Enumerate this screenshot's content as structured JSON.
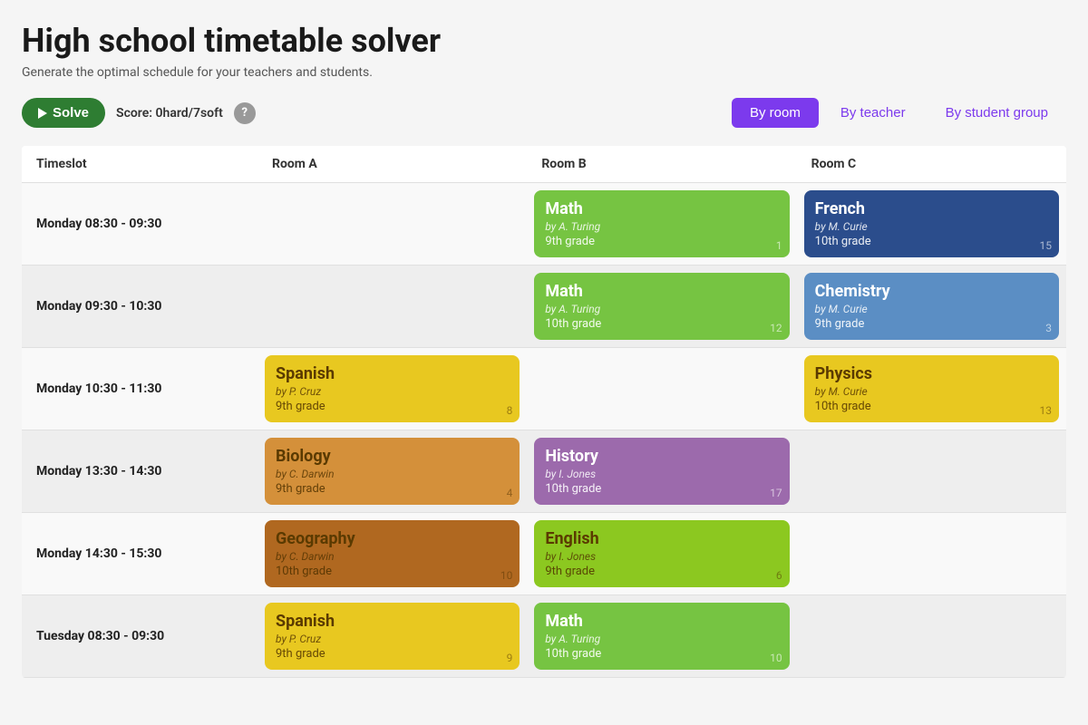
{
  "page": {
    "title": "High school timetable solver",
    "subtitle": "Generate the optimal schedule for your teachers and students."
  },
  "toolbar": {
    "solve_label": "Solve",
    "score_label": "Score: 0hard/7soft",
    "help_label": "?"
  },
  "view_tabs": [
    {
      "id": "by-room",
      "label": "By room",
      "active": true
    },
    {
      "id": "by-teacher",
      "label": "By teacher",
      "active": false
    },
    {
      "id": "by-student-group",
      "label": "By student group",
      "active": false
    }
  ],
  "columns": [
    {
      "id": "timeslot",
      "label": "Timeslot"
    },
    {
      "id": "room-a",
      "label": "Room A"
    },
    {
      "id": "room-b",
      "label": "Room B"
    },
    {
      "id": "room-c",
      "label": "Room C"
    }
  ],
  "rows": [
    {
      "timeslot": "Monday 08:30 - 09:30",
      "room_a": null,
      "room_b": {
        "subject": "Math",
        "teacher": "by A. Turing",
        "grade": "9th grade",
        "number": "1",
        "color": "green"
      },
      "room_c": {
        "subject": "French",
        "teacher": "by M. Curie",
        "grade": "10th grade",
        "number": "15",
        "color": "dark-blue"
      }
    },
    {
      "timeslot": "Monday 09:30 - 10:30",
      "room_a": null,
      "room_b": {
        "subject": "Math",
        "teacher": "by A. Turing",
        "grade": "10th grade",
        "number": "12",
        "color": "green"
      },
      "room_c": {
        "subject": "Chemistry",
        "teacher": "by M. Curie",
        "grade": "9th grade",
        "number": "3",
        "color": "blue"
      }
    },
    {
      "timeslot": "Monday 10:30 - 11:30",
      "room_a": {
        "subject": "Spanish",
        "teacher": "by P. Cruz",
        "grade": "9th grade",
        "number": "8",
        "color": "yellow",
        "dark": true
      },
      "room_b": null,
      "room_c": {
        "subject": "Physics",
        "teacher": "by M. Curie",
        "grade": "10th grade",
        "number": "13",
        "color": "yellow",
        "dark": true
      }
    },
    {
      "timeslot": "Monday 13:30 - 14:30",
      "room_a": {
        "subject": "Biology",
        "teacher": "by C. Darwin",
        "grade": "9th grade",
        "number": "4",
        "color": "orange",
        "dark": true
      },
      "room_b": {
        "subject": "History",
        "teacher": "by I. Jones",
        "grade": "10th grade",
        "number": "17",
        "color": "purple"
      },
      "room_c": null
    },
    {
      "timeslot": "Monday 14:30 - 15:30",
      "room_a": {
        "subject": "Geography",
        "teacher": "by C. Darwin",
        "grade": "10th grade",
        "number": "10",
        "color": "dark-orange",
        "dark": true
      },
      "room_b": {
        "subject": "English",
        "teacher": "by I. Jones",
        "grade": "9th grade",
        "number": "6",
        "color": "lime",
        "dark": true
      },
      "room_c": null
    },
    {
      "timeslot": "Tuesday 08:30 - 09:30",
      "room_a": {
        "subject": "Spanish",
        "teacher": "by P. Cruz",
        "grade": "9th grade",
        "number": "9",
        "color": "yellow",
        "dark": true
      },
      "room_b": {
        "subject": "Math",
        "teacher": "by A. Turing",
        "grade": "10th grade",
        "number": "10",
        "color": "green"
      },
      "room_c": null
    }
  ]
}
